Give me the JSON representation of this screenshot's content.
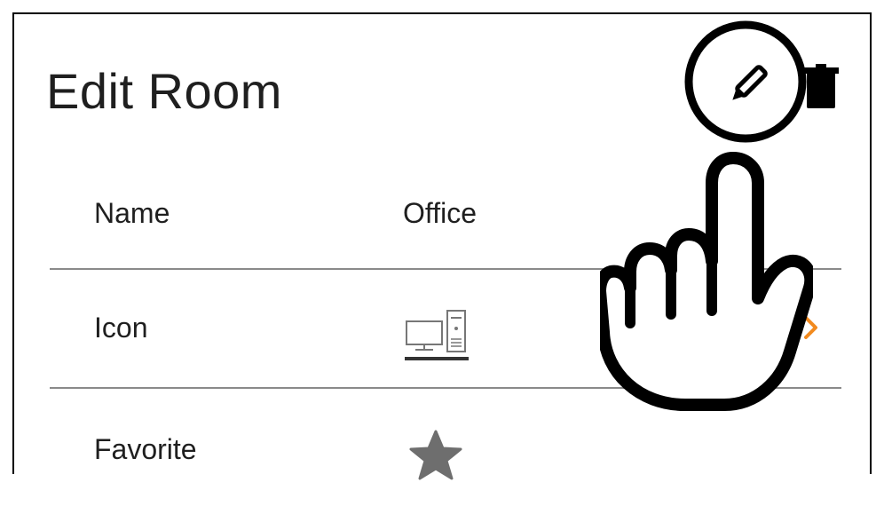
{
  "header": {
    "title": "Edit Room",
    "edit_icon": "pencil-icon",
    "delete_icon": "trash-icon"
  },
  "rows": [
    {
      "label": "Name",
      "value": "Office"
    },
    {
      "label": "Icon",
      "value_icon": "office-desk-computer-icon",
      "action_icon": "chevron-right-icon"
    },
    {
      "label": "Favorite",
      "value_icon": "star-icon"
    }
  ],
  "overlay": {
    "magnifier_icon": "magnifier-circle",
    "hand_icon": "pointing-hand-icon"
  },
  "colors": {
    "text": "#1f1f1f",
    "divider": "#8a8a8a",
    "chevron": "#f28a1e",
    "star": "#6e6e6e"
  }
}
